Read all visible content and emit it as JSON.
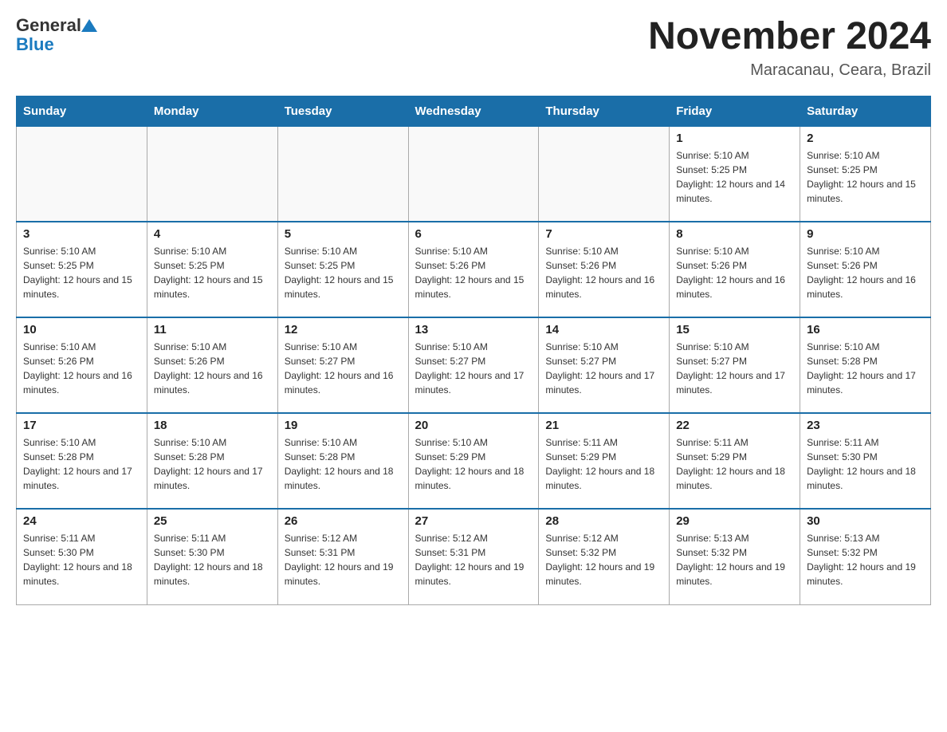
{
  "header": {
    "logo_general": "General",
    "logo_blue": "Blue",
    "month_title": "November 2024",
    "location": "Maracanau, Ceara, Brazil"
  },
  "days_of_week": [
    "Sunday",
    "Monday",
    "Tuesday",
    "Wednesday",
    "Thursday",
    "Friday",
    "Saturday"
  ],
  "weeks": [
    [
      {
        "day": "",
        "sunrise": "",
        "sunset": "",
        "daylight": ""
      },
      {
        "day": "",
        "sunrise": "",
        "sunset": "",
        "daylight": ""
      },
      {
        "day": "",
        "sunrise": "",
        "sunset": "",
        "daylight": ""
      },
      {
        "day": "",
        "sunrise": "",
        "sunset": "",
        "daylight": ""
      },
      {
        "day": "",
        "sunrise": "",
        "sunset": "",
        "daylight": ""
      },
      {
        "day": "1",
        "sunrise": "Sunrise: 5:10 AM",
        "sunset": "Sunset: 5:25 PM",
        "daylight": "Daylight: 12 hours and 14 minutes."
      },
      {
        "day": "2",
        "sunrise": "Sunrise: 5:10 AM",
        "sunset": "Sunset: 5:25 PM",
        "daylight": "Daylight: 12 hours and 15 minutes."
      }
    ],
    [
      {
        "day": "3",
        "sunrise": "Sunrise: 5:10 AM",
        "sunset": "Sunset: 5:25 PM",
        "daylight": "Daylight: 12 hours and 15 minutes."
      },
      {
        "day": "4",
        "sunrise": "Sunrise: 5:10 AM",
        "sunset": "Sunset: 5:25 PM",
        "daylight": "Daylight: 12 hours and 15 minutes."
      },
      {
        "day": "5",
        "sunrise": "Sunrise: 5:10 AM",
        "sunset": "Sunset: 5:25 PM",
        "daylight": "Daylight: 12 hours and 15 minutes."
      },
      {
        "day": "6",
        "sunrise": "Sunrise: 5:10 AM",
        "sunset": "Sunset: 5:26 PM",
        "daylight": "Daylight: 12 hours and 15 minutes."
      },
      {
        "day": "7",
        "sunrise": "Sunrise: 5:10 AM",
        "sunset": "Sunset: 5:26 PM",
        "daylight": "Daylight: 12 hours and 16 minutes."
      },
      {
        "day": "8",
        "sunrise": "Sunrise: 5:10 AM",
        "sunset": "Sunset: 5:26 PM",
        "daylight": "Daylight: 12 hours and 16 minutes."
      },
      {
        "day": "9",
        "sunrise": "Sunrise: 5:10 AM",
        "sunset": "Sunset: 5:26 PM",
        "daylight": "Daylight: 12 hours and 16 minutes."
      }
    ],
    [
      {
        "day": "10",
        "sunrise": "Sunrise: 5:10 AM",
        "sunset": "Sunset: 5:26 PM",
        "daylight": "Daylight: 12 hours and 16 minutes."
      },
      {
        "day": "11",
        "sunrise": "Sunrise: 5:10 AM",
        "sunset": "Sunset: 5:26 PM",
        "daylight": "Daylight: 12 hours and 16 minutes."
      },
      {
        "day": "12",
        "sunrise": "Sunrise: 5:10 AM",
        "sunset": "Sunset: 5:27 PM",
        "daylight": "Daylight: 12 hours and 16 minutes."
      },
      {
        "day": "13",
        "sunrise": "Sunrise: 5:10 AM",
        "sunset": "Sunset: 5:27 PM",
        "daylight": "Daylight: 12 hours and 17 minutes."
      },
      {
        "day": "14",
        "sunrise": "Sunrise: 5:10 AM",
        "sunset": "Sunset: 5:27 PM",
        "daylight": "Daylight: 12 hours and 17 minutes."
      },
      {
        "day": "15",
        "sunrise": "Sunrise: 5:10 AM",
        "sunset": "Sunset: 5:27 PM",
        "daylight": "Daylight: 12 hours and 17 minutes."
      },
      {
        "day": "16",
        "sunrise": "Sunrise: 5:10 AM",
        "sunset": "Sunset: 5:28 PM",
        "daylight": "Daylight: 12 hours and 17 minutes."
      }
    ],
    [
      {
        "day": "17",
        "sunrise": "Sunrise: 5:10 AM",
        "sunset": "Sunset: 5:28 PM",
        "daylight": "Daylight: 12 hours and 17 minutes."
      },
      {
        "day": "18",
        "sunrise": "Sunrise: 5:10 AM",
        "sunset": "Sunset: 5:28 PM",
        "daylight": "Daylight: 12 hours and 17 minutes."
      },
      {
        "day": "19",
        "sunrise": "Sunrise: 5:10 AM",
        "sunset": "Sunset: 5:28 PM",
        "daylight": "Daylight: 12 hours and 18 minutes."
      },
      {
        "day": "20",
        "sunrise": "Sunrise: 5:10 AM",
        "sunset": "Sunset: 5:29 PM",
        "daylight": "Daylight: 12 hours and 18 minutes."
      },
      {
        "day": "21",
        "sunrise": "Sunrise: 5:11 AM",
        "sunset": "Sunset: 5:29 PM",
        "daylight": "Daylight: 12 hours and 18 minutes."
      },
      {
        "day": "22",
        "sunrise": "Sunrise: 5:11 AM",
        "sunset": "Sunset: 5:29 PM",
        "daylight": "Daylight: 12 hours and 18 minutes."
      },
      {
        "day": "23",
        "sunrise": "Sunrise: 5:11 AM",
        "sunset": "Sunset: 5:30 PM",
        "daylight": "Daylight: 12 hours and 18 minutes."
      }
    ],
    [
      {
        "day": "24",
        "sunrise": "Sunrise: 5:11 AM",
        "sunset": "Sunset: 5:30 PM",
        "daylight": "Daylight: 12 hours and 18 minutes."
      },
      {
        "day": "25",
        "sunrise": "Sunrise: 5:11 AM",
        "sunset": "Sunset: 5:30 PM",
        "daylight": "Daylight: 12 hours and 18 minutes."
      },
      {
        "day": "26",
        "sunrise": "Sunrise: 5:12 AM",
        "sunset": "Sunset: 5:31 PM",
        "daylight": "Daylight: 12 hours and 19 minutes."
      },
      {
        "day": "27",
        "sunrise": "Sunrise: 5:12 AM",
        "sunset": "Sunset: 5:31 PM",
        "daylight": "Daylight: 12 hours and 19 minutes."
      },
      {
        "day": "28",
        "sunrise": "Sunrise: 5:12 AM",
        "sunset": "Sunset: 5:32 PM",
        "daylight": "Daylight: 12 hours and 19 minutes."
      },
      {
        "day": "29",
        "sunrise": "Sunrise: 5:13 AM",
        "sunset": "Sunset: 5:32 PM",
        "daylight": "Daylight: 12 hours and 19 minutes."
      },
      {
        "day": "30",
        "sunrise": "Sunrise: 5:13 AM",
        "sunset": "Sunset: 5:32 PM",
        "daylight": "Daylight: 12 hours and 19 minutes."
      }
    ]
  ]
}
